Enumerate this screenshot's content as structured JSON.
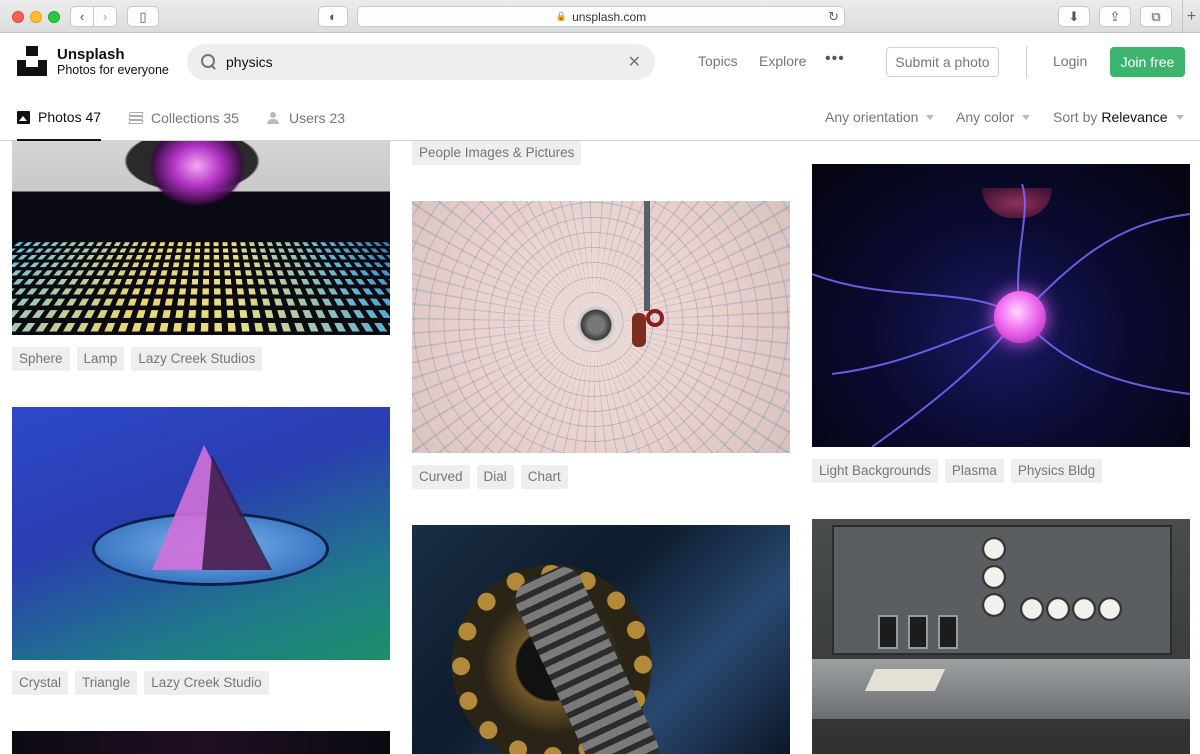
{
  "browser": {
    "url": "unsplash.com"
  },
  "header": {
    "brand_name": "Unsplash",
    "brand_tagline": "Photos for everyone",
    "search_value": "physics",
    "nav": [
      "Topics",
      "Explore"
    ],
    "more": "•••",
    "submit_label": "Submit a photo",
    "login_label": "Login",
    "join_label": "Join free",
    "join_color": "#3cb46e"
  },
  "subnav": {
    "tabs": [
      {
        "label": "Photos 47",
        "active": true,
        "icon": "photo-icon"
      },
      {
        "label": "Collections 35",
        "active": false,
        "icon": "collections-icon"
      },
      {
        "label": "Users 23",
        "active": false,
        "icon": "users-icon"
      }
    ],
    "filters": {
      "orientation": "Any orientation",
      "color": "Any color",
      "sort_prefix": "Sort by",
      "sort_value": "Relevance"
    }
  },
  "results": {
    "col1": [
      {
        "tags": [
          "Sphere",
          "Lamp",
          "Lazy Creek Studios"
        ]
      },
      {
        "tags": [
          "Crystal",
          "Triangle",
          "Lazy Creek Studio"
        ]
      }
    ],
    "col2": [
      {
        "tags": [
          "People Images & Pictures"
        ]
      },
      {
        "tags": [
          "Curved",
          "Dial",
          "Chart"
        ]
      }
    ],
    "col3": [
      {
        "tags": [
          "Light Backgrounds",
          "Plasma",
          "Physics Bldg"
        ]
      }
    ]
  }
}
